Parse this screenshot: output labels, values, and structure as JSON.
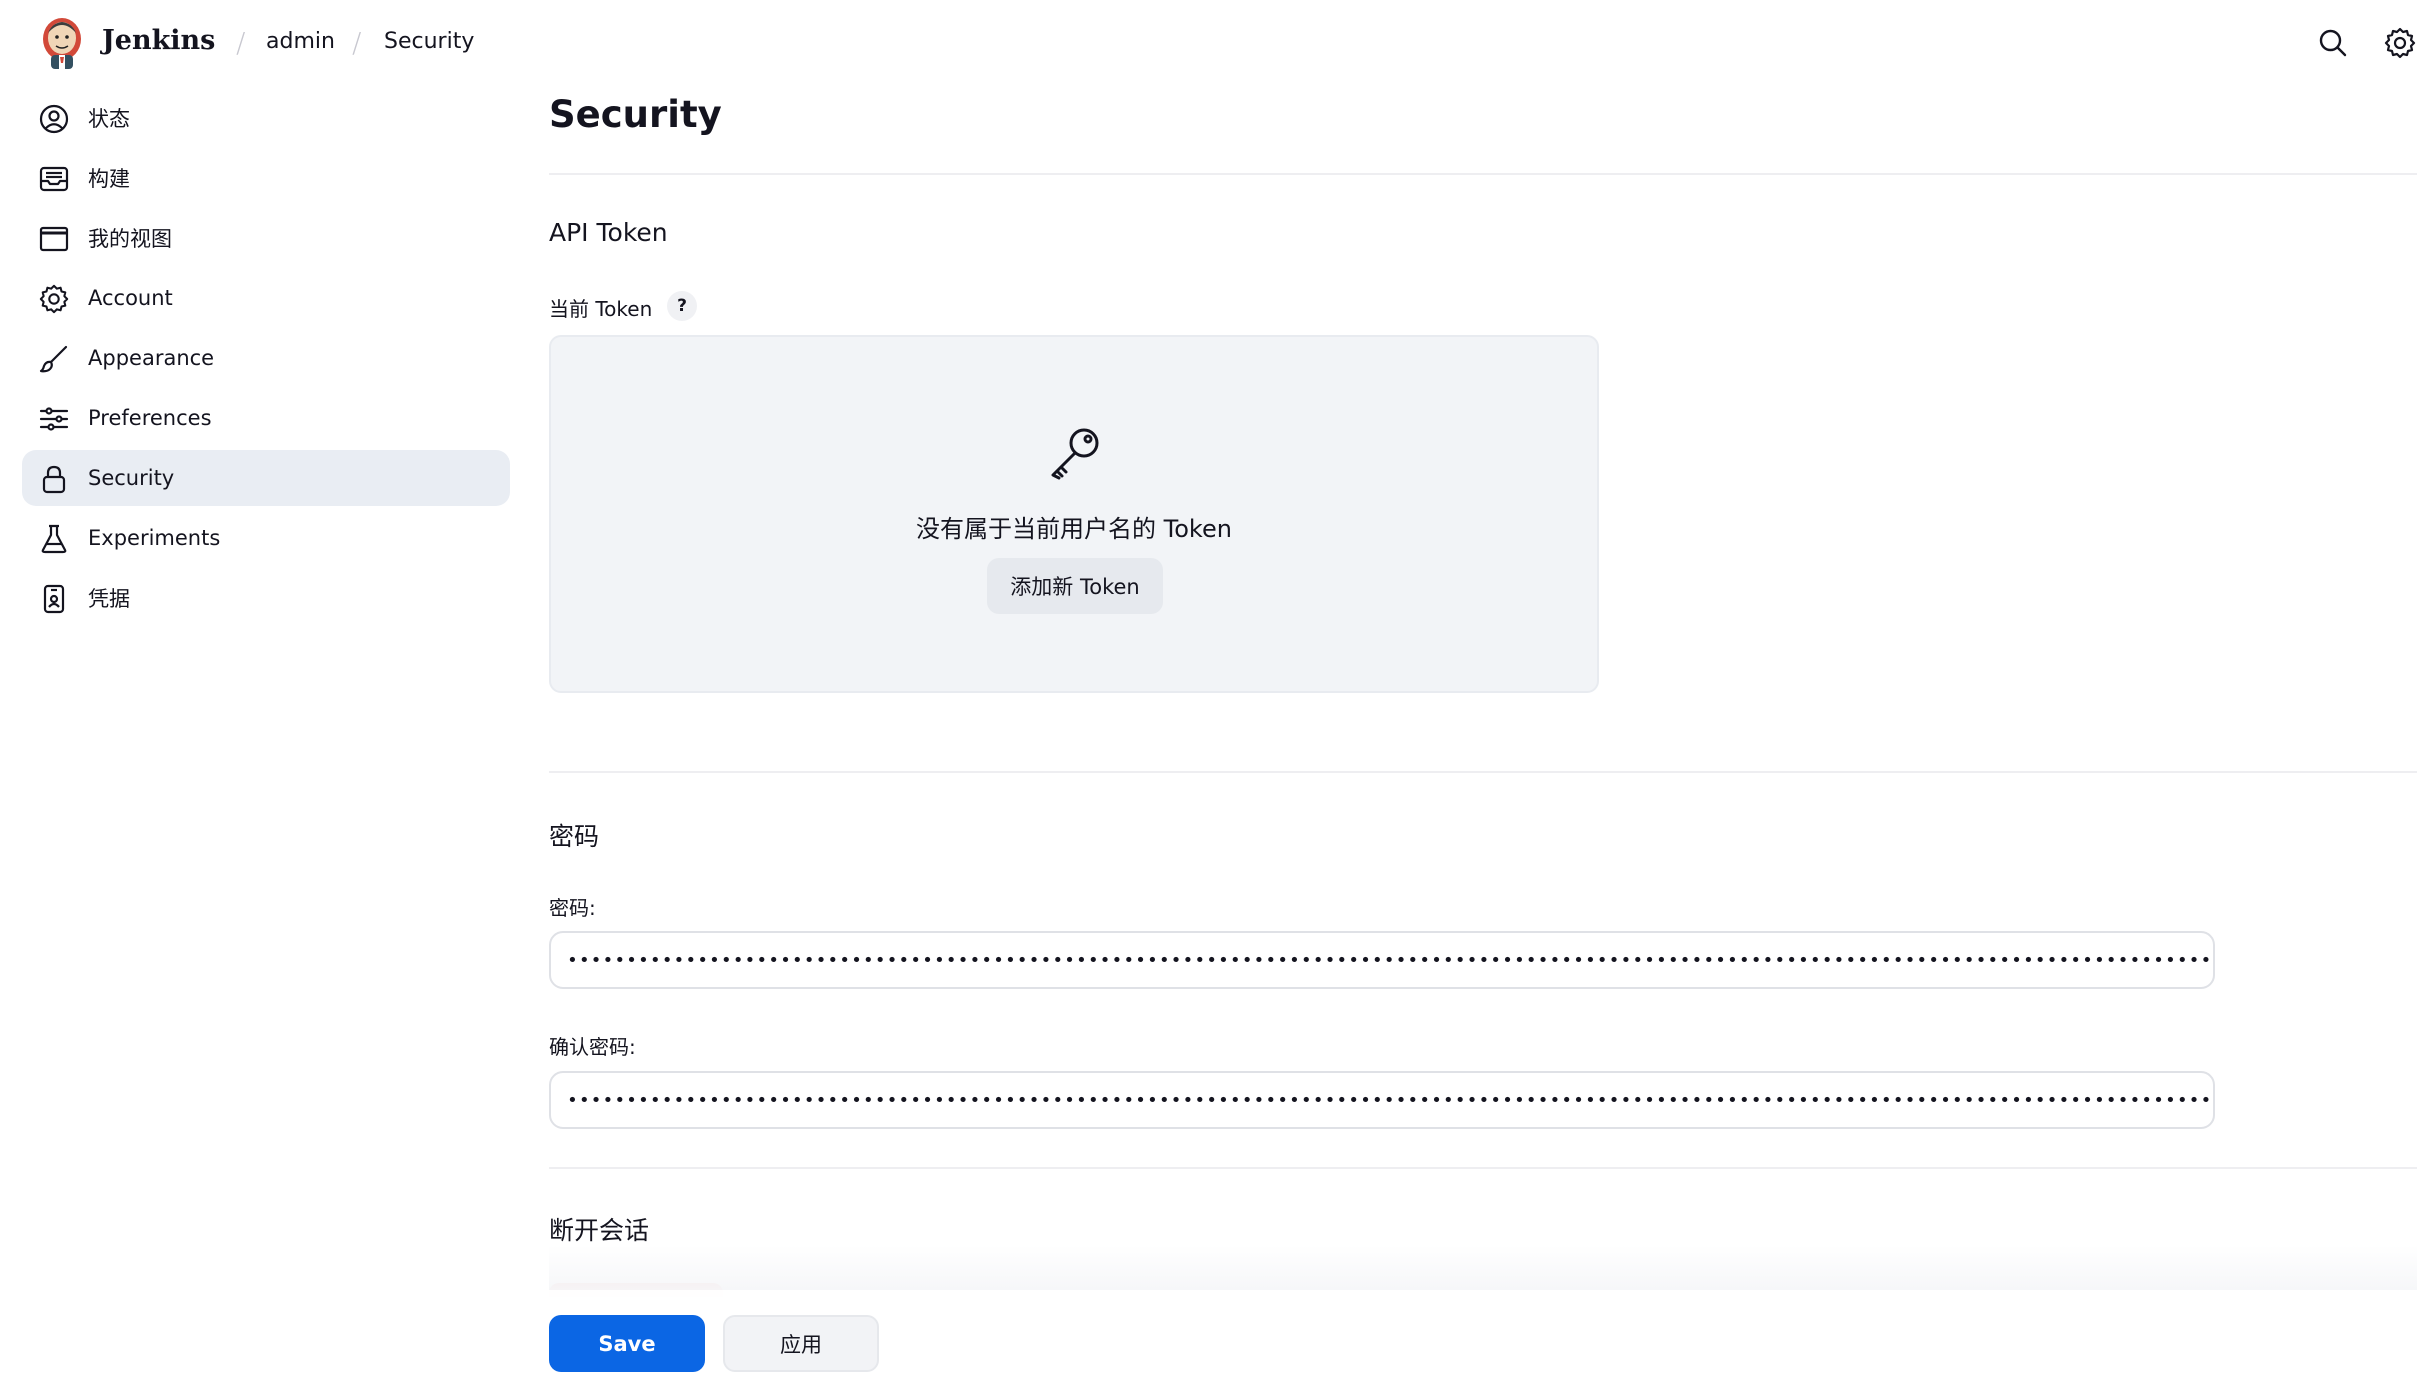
{
  "header": {
    "brand": "Jenkins",
    "breadcrumbs": [
      "admin",
      "Security"
    ]
  },
  "sidebar": {
    "items": [
      {
        "label": "状态",
        "icon": "user-circle-icon"
      },
      {
        "label": "构建",
        "icon": "inbox-icon"
      },
      {
        "label": "我的视图",
        "icon": "window-icon"
      },
      {
        "label": "Account",
        "icon": "gear-icon"
      },
      {
        "label": "Appearance",
        "icon": "brush-icon"
      },
      {
        "label": "Preferences",
        "icon": "sliders-icon"
      },
      {
        "label": "Security",
        "icon": "lock-icon",
        "active": true
      },
      {
        "label": "Experiments",
        "icon": "flask-icon"
      },
      {
        "label": "凭据",
        "icon": "id-badge-icon"
      }
    ]
  },
  "main": {
    "title": "Security",
    "api_token": {
      "section_title": "API Token",
      "current_label": "当前 Token",
      "help": "?",
      "empty_message": "没有属于当前用户名的 Token",
      "add_button": "添加新 Token"
    },
    "password": {
      "section_title": "密码",
      "password_label": "密码:",
      "password_value": "••••••••••••••••••••••••••••••••••••••••••••••••••••••••••••••••••••••••••••••••••••••••••••••••••••••••••••••••••••••••••••••••••••••••••••••••••••••••••••••••••",
      "confirm_label": "确认密码:",
      "confirm_value": "••••••••••••••••••••••••••••••••••••••••••••••••••••••••••••••••••••••••••••••••••••••••••••••••••••••••••••••••••••••••••••••••••••••••••••••••••••••••••••••••••"
    },
    "sessions": {
      "section_title": "断开会话"
    }
  },
  "footer": {
    "save": "Save",
    "apply": "应用"
  },
  "colors": {
    "primary": "#0b66e4",
    "active_bg": "#e9edf3",
    "token_box_bg": "#f2f4f7"
  }
}
